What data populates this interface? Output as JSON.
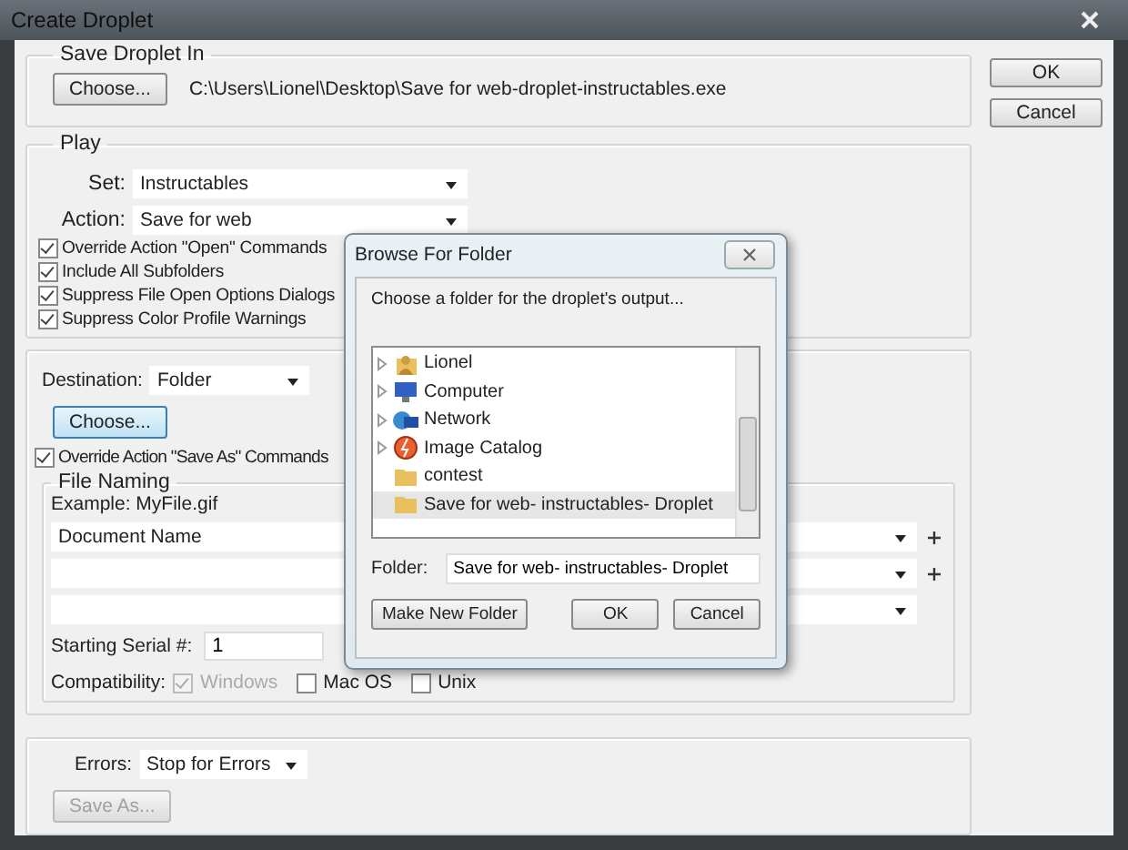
{
  "window": {
    "title": "Create Droplet"
  },
  "save_droplet_in": {
    "legend": "Save Droplet In",
    "choose_button": "Choose...",
    "path": "C:\\Users\\Lionel\\Desktop\\Save for web-droplet-instructables.exe"
  },
  "play": {
    "legend": "Play",
    "set": {
      "label": "Set:",
      "value": "Instructables"
    },
    "action": {
      "label": "Action:",
      "value": "Save for web"
    },
    "options": [
      {
        "label": "Override Action \"Open\" Commands",
        "checked": true
      },
      {
        "label": "Include All Subfolders",
        "checked": true
      },
      {
        "label": "Suppress File Open Options Dialogs",
        "checked": true
      },
      {
        "label": "Suppress Color Profile Warnings",
        "checked": true
      }
    ]
  },
  "destination": {
    "label": "Destination:",
    "value": "Folder",
    "choose_button": "Choose...",
    "override": {
      "label": "Override Action \"Save As\" Commands",
      "checked": true
    },
    "file_naming": {
      "legend": "File Naming",
      "example": "Example: MyFile.gif",
      "fields": [
        {
          "value": "Document Name",
          "add": true
        },
        {
          "add": true
        },
        {
          "add": false
        }
      ],
      "serial": {
        "label": "Starting Serial #:",
        "value": "1"
      },
      "compatibility": {
        "label": "Compatibility:",
        "options": [
          {
            "label": "Windows",
            "checked": true,
            "disabled": true
          },
          {
            "label": "Mac OS",
            "checked": false,
            "disabled": false
          },
          {
            "label": "Unix",
            "checked": false,
            "disabled": false
          }
        ]
      }
    }
  },
  "errors": {
    "label": "Errors:",
    "value": "Stop for Errors",
    "save_as_button": "Save As...",
    "save_as_disabled": true
  },
  "buttons": [
    "OK",
    "Cancel"
  ],
  "browse_dialog": {
    "title": "Browse For Folder",
    "prompt": "Choose a folder for the droplet's output...",
    "tree": [
      {
        "label": "Lionel",
        "kind": "user",
        "expandable": true,
        "selected": false
      },
      {
        "label": "Computer",
        "kind": "computer",
        "expandable": true,
        "selected": false
      },
      {
        "label": "Network",
        "kind": "network",
        "expandable": true,
        "selected": false
      },
      {
        "label": "Image Catalog",
        "kind": "catalog",
        "expandable": true,
        "selected": false
      },
      {
        "label": "contest",
        "kind": "folder",
        "expandable": false,
        "selected": false
      },
      {
        "label": "Save for web- instructables- Droplet",
        "kind": "folder",
        "expandable": false,
        "selected": true
      }
    ],
    "folder": {
      "label": "Folder:",
      "value": "Save for web- instructables- Droplet"
    },
    "buttons": [
      "Make New Folder",
      "OK",
      "Cancel"
    ]
  }
}
